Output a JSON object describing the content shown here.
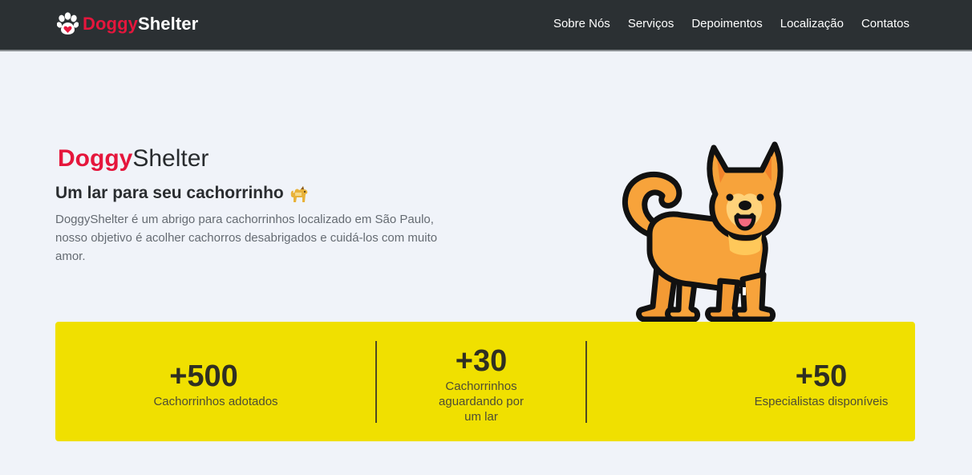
{
  "brand": {
    "part1": "Doggy",
    "part2": "Shelter",
    "logo_icon": "paw-heart-icon"
  },
  "nav": {
    "items": [
      {
        "label": "Sobre Nós"
      },
      {
        "label": "Serviços"
      },
      {
        "label": "Depoimentos"
      },
      {
        "label": "Localização"
      },
      {
        "label": "Contatos"
      }
    ]
  },
  "hero": {
    "brand_part1": "Doggy",
    "brand_part2": "Shelter",
    "heading": "Um lar para seu cachorrinho",
    "heading_icon": "dog-emoji-icon",
    "description": "DoggyShelter é um abrigo para cachorrinhos localizado em São Paulo, nosso objetivo é acolher cachorros desabrigados e cuidá-los com muito amor.",
    "illustration": "dog-illustration"
  },
  "stats": [
    {
      "value": "+500",
      "label": "Cachorrinhos adotados"
    },
    {
      "value": "+30",
      "label": "Cachorrinhos aguardando por um lar"
    },
    {
      "value": "+50",
      "label": "Especialistas disponíveis"
    }
  ],
  "colors": {
    "navbar": "#2b3033",
    "brand_red": "#e5163c",
    "page_bg": "#f0f3f9",
    "stats_bg": "#f0e000"
  }
}
